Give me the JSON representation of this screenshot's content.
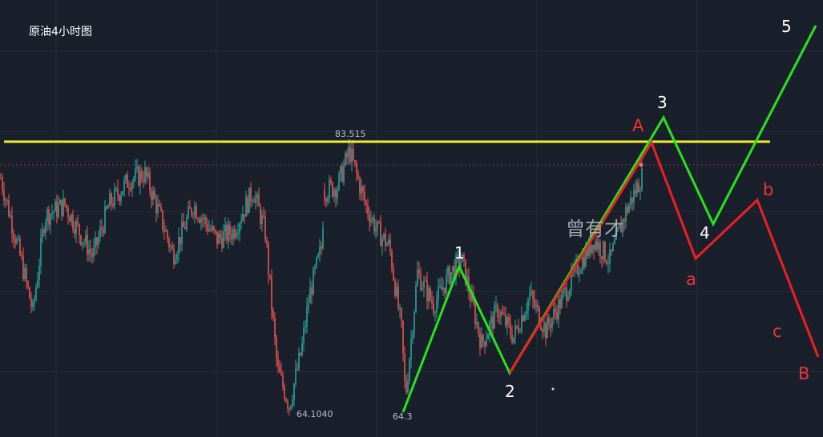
{
  "page": {
    "title": "原油4小时图",
    "watermark": "曾有才"
  },
  "colors": {
    "background": "#1a202b",
    "up_candle": "#26a69a",
    "down_candle": "#ef5350",
    "resistance_line": "#f2ee27",
    "impulse_wave": "#27e21d",
    "corrective_wave": "#f01e23",
    "label_white": "#ffffff",
    "label_red": "#f03338"
  },
  "chart_data": {
    "type": "candlestick",
    "title": "原油4小时图",
    "grid": true,
    "resistance_level": {
      "label": "83.515",
      "value": 83.515
    },
    "price_labels": [
      {
        "id": "low1",
        "text": "64.1040",
        "value": 64.104
      },
      {
        "id": "low2",
        "text": "64.3",
        "value": 64.3
      }
    ],
    "impulse_wave_labels": [
      "1",
      "2",
      "3",
      "4",
      "5"
    ],
    "corrective_wave_labels": [
      "A",
      "a",
      "b",
      "c",
      "B"
    ],
    "candle_anchors_price": [
      [
        0,
        80.9
      ],
      [
        25,
        75.1
      ],
      [
        40,
        71.3
      ],
      [
        55,
        78.2
      ],
      [
        80,
        79.0
      ],
      [
        100,
        76.8
      ],
      [
        115,
        75.3
      ],
      [
        135,
        79.0
      ],
      [
        160,
        80.8
      ],
      [
        180,
        81.2
      ],
      [
        200,
        78.0
      ],
      [
        215,
        75.4
      ],
      [
        240,
        79.0
      ],
      [
        270,
        76.5
      ],
      [
        290,
        77.1
      ],
      [
        315,
        80.0
      ],
      [
        330,
        77.0
      ],
      [
        345,
        67.2
      ],
      [
        360,
        64.6
      ],
      [
        375,
        68.5
      ],
      [
        385,
        72.5
      ],
      [
        400,
        75.9
      ],
      [
        404,
        80.0
      ],
      [
        420,
        80.3
      ],
      [
        435,
        82.9
      ],
      [
        455,
        79.0
      ],
      [
        470,
        77.1
      ],
      [
        485,
        76.0
      ],
      [
        500,
        70.0
      ],
      [
        505,
        65.2
      ],
      [
        520,
        74.1
      ],
      [
        540,
        71.8
      ],
      [
        560,
        74.0
      ],
      [
        575,
        75.1
      ],
      [
        590,
        71.5
      ],
      [
        600,
        69.0
      ],
      [
        620,
        71.5
      ],
      [
        640,
        69.5
      ],
      [
        660,
        72.5
      ],
      [
        680,
        70.0
      ],
      [
        700,
        72.2
      ],
      [
        720,
        74.5
      ],
      [
        740,
        76.5
      ],
      [
        760,
        75.0
      ],
      [
        780,
        78.5
      ],
      [
        800,
        81.0
      ]
    ]
  }
}
